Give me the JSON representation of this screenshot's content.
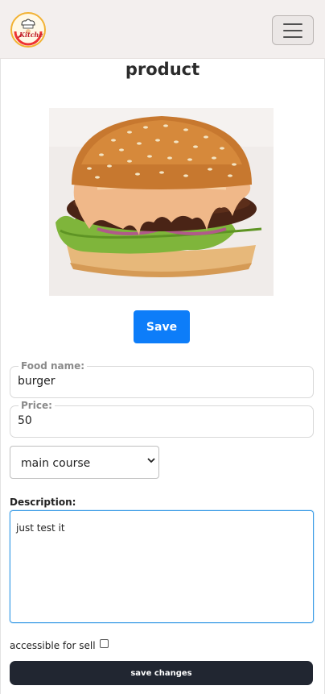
{
  "navbar": {
    "logo_icon": "kitchen-chef-logo",
    "logo_text": "Kitchen",
    "menu_icon": "hamburger-menu-icon"
  },
  "page": {
    "title": "product"
  },
  "image": {
    "subject": "burger-photo"
  },
  "form": {
    "save_label": "Save",
    "food_name": {
      "label": "Food name:",
      "value": "burger"
    },
    "price": {
      "label": "Price:",
      "value": "50"
    },
    "category": {
      "selected": "main course"
    },
    "description": {
      "label": "Description:",
      "value": "just test it"
    },
    "accessible": {
      "label": "accessible for sell",
      "checked": false
    },
    "submit_label": "save changes"
  },
  "colors": {
    "primary": "#0d7df9",
    "dark": "#212631",
    "navbar_bg": "#f3efee",
    "focus": "#3b9ce6"
  }
}
